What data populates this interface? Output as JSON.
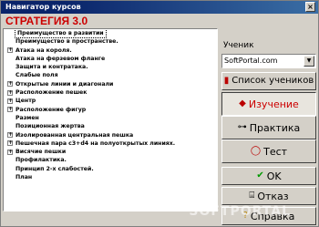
{
  "window": {
    "title": "Навигатор курсов"
  },
  "brand": {
    "label": "СТРАТЕГИЯ 3.0"
  },
  "tree": {
    "items": [
      {
        "label": "Преимущество в развитии",
        "expandable": false
      },
      {
        "label": "Преимущество в пространстве.",
        "expandable": false
      },
      {
        "label": "Атака на короля.",
        "expandable": true
      },
      {
        "label": "Атака на ферзевом фланге",
        "expandable": false
      },
      {
        "label": "Защита и контратака.",
        "expandable": false
      },
      {
        "label": "Слабые поля",
        "expandable": false
      },
      {
        "label": "Открытые линии и диагонали",
        "expandable": true
      },
      {
        "label": "Расположение пешек",
        "expandable": true
      },
      {
        "label": "Центр",
        "expandable": true
      },
      {
        "label": "Расположение фигур",
        "expandable": true
      },
      {
        "label": "Размен",
        "expandable": false
      },
      {
        "label": "Позиционная жертва",
        "expandable": false
      },
      {
        "label": "Изолированная центральная пешка",
        "expandable": true
      },
      {
        "label": "Пешечная пара c3+d4 на полуоткрытых линиях.",
        "expandable": true
      },
      {
        "label": "Висячие пешки",
        "expandable": true
      },
      {
        "label": "Профилактика.",
        "expandable": false
      },
      {
        "label": "Принцип 2-х слабостей.",
        "expandable": false
      },
      {
        "label": "План",
        "expandable": false
      }
    ]
  },
  "student": {
    "label": "Ученик",
    "value": "SoftPortal.com"
  },
  "buttons": {
    "students_list": "Список учеников",
    "study": "Изучение",
    "practice": "Практика",
    "test": "Тест",
    "ok": "OK",
    "cancel": "Отказ",
    "help": "Справка"
  },
  "watermark": "SOFTPORTAL"
}
